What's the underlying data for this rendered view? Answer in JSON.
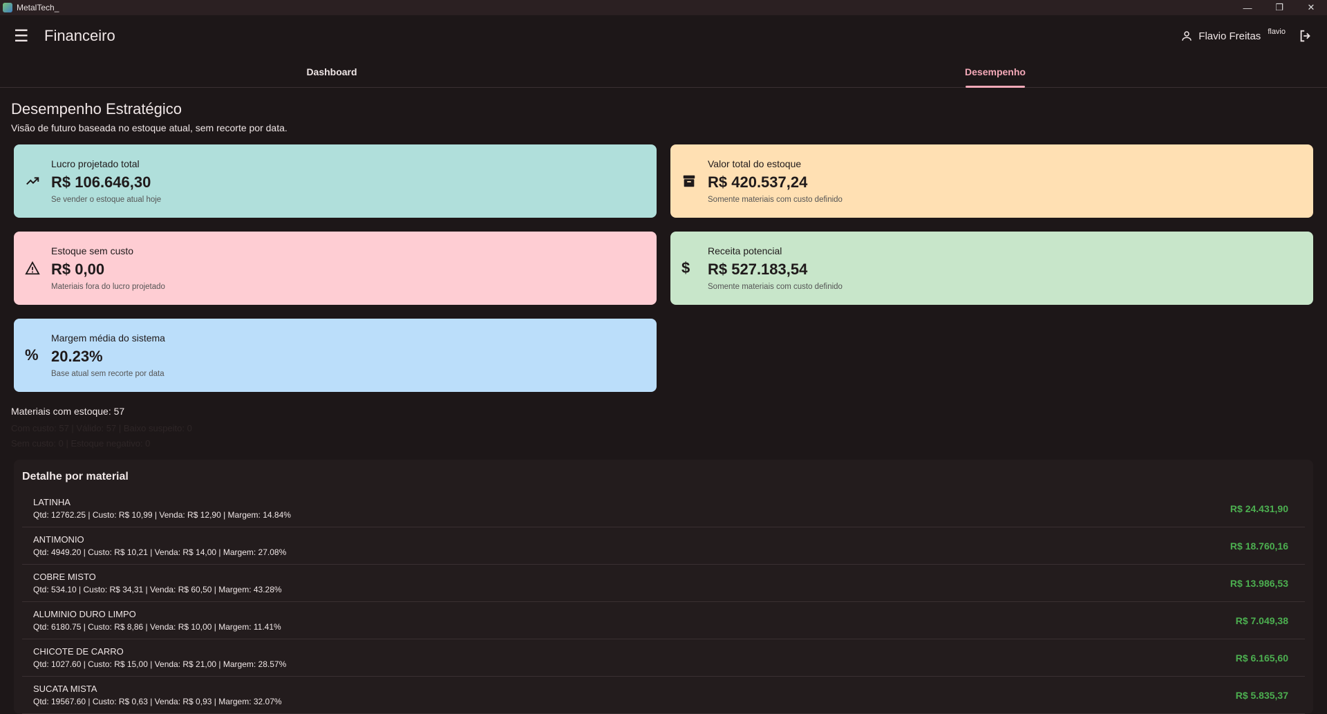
{
  "window": {
    "title": "MetalTech_",
    "controls": {
      "minimize": "—",
      "restore": "❐",
      "close": "✕"
    }
  },
  "appbar": {
    "title": "Financeiro",
    "menu_icon": "☰",
    "user_name": "Flavio Freitas",
    "username": "flavio"
  },
  "tabs": [
    {
      "label": "Dashboard",
      "active": false
    },
    {
      "label": "Desempenho",
      "active": true
    }
  ],
  "page": {
    "title": "Desempenho Estratégico",
    "subtitle": "Visão de futuro baseada no estoque atual, sem recorte por data."
  },
  "cards": [
    {
      "icon": "trending-up-icon",
      "glyph": "↗",
      "label": "Lucro projetado total",
      "value": "R$ 106.646,30",
      "hint": "Se vender o estoque atual hoje",
      "color": "#b0dfdb"
    },
    {
      "icon": "archive-icon",
      "glyph": "▦",
      "label": "Valor total do estoque",
      "value": "R$ 420.537,24",
      "hint": "Somente materiais com custo definido",
      "color": "#ffe0b3"
    },
    {
      "icon": "warning-icon",
      "glyph": "⚠",
      "label": "Estoque sem custo",
      "value": "R$ 0,00",
      "hint": "Materiais fora do lucro projetado",
      "color": "#fecdd3"
    },
    {
      "icon": "dollar-icon",
      "glyph": "$",
      "label": "Receita potencial",
      "value": "R$ 527.183,54",
      "hint": "Somente materiais com custo definido",
      "color": "#c8e6ca"
    },
    {
      "icon": "percent-icon",
      "glyph": "%",
      "label": "Margem média do sistema",
      "value": "20.23%",
      "hint": "Base atual sem recorte por data",
      "color": "#bbdefa"
    }
  ],
  "stats": {
    "materials": "Materiais com estoque: 57",
    "line1": "Com custo: 57  |  Válido: 57  |  Baixo suspeito: 0",
    "line2": "Sem custo: 0  |  Estoque negativo: 0"
  },
  "detail": {
    "title": "Detalhe por material",
    "rows": [
      {
        "name": "LATINHA",
        "info": "Qtd: 12762.25  |  Custo: R$ 10,99  |  Venda: R$ 12,90  |  Margem: 14.84%",
        "amount": "R$ 24.431,90"
      },
      {
        "name": "ANTIMONIO",
        "info": "Qtd: 4949.20  |  Custo: R$ 10,21  |  Venda: R$ 14,00  |  Margem: 27.08%",
        "amount": "R$ 18.760,16"
      },
      {
        "name": "COBRE MISTO",
        "info": "Qtd: 534.10  |  Custo: R$ 34,31  |  Venda: R$ 60,50  |  Margem: 43.28%",
        "amount": "R$ 13.986,53"
      },
      {
        "name": "ALUMINIO DURO LIMPO",
        "info": "Qtd: 6180.75  |  Custo: R$ 8,86  |  Venda: R$ 10,00  |  Margem: 11.41%",
        "amount": "R$ 7.049,38"
      },
      {
        "name": "CHICOTE DE CARRO",
        "info": "Qtd: 1027.60  |  Custo: R$ 15,00  |  Venda: R$ 21,00  |  Margem: 28.57%",
        "amount": "R$ 6.165,60"
      },
      {
        "name": "SUCATA MISTA",
        "info": "Qtd: 19567.60  |  Custo: R$ 0,63  |  Venda: R$ 0,93  |  Margem: 32.07%",
        "amount": "R$ 5.835,37"
      }
    ]
  }
}
